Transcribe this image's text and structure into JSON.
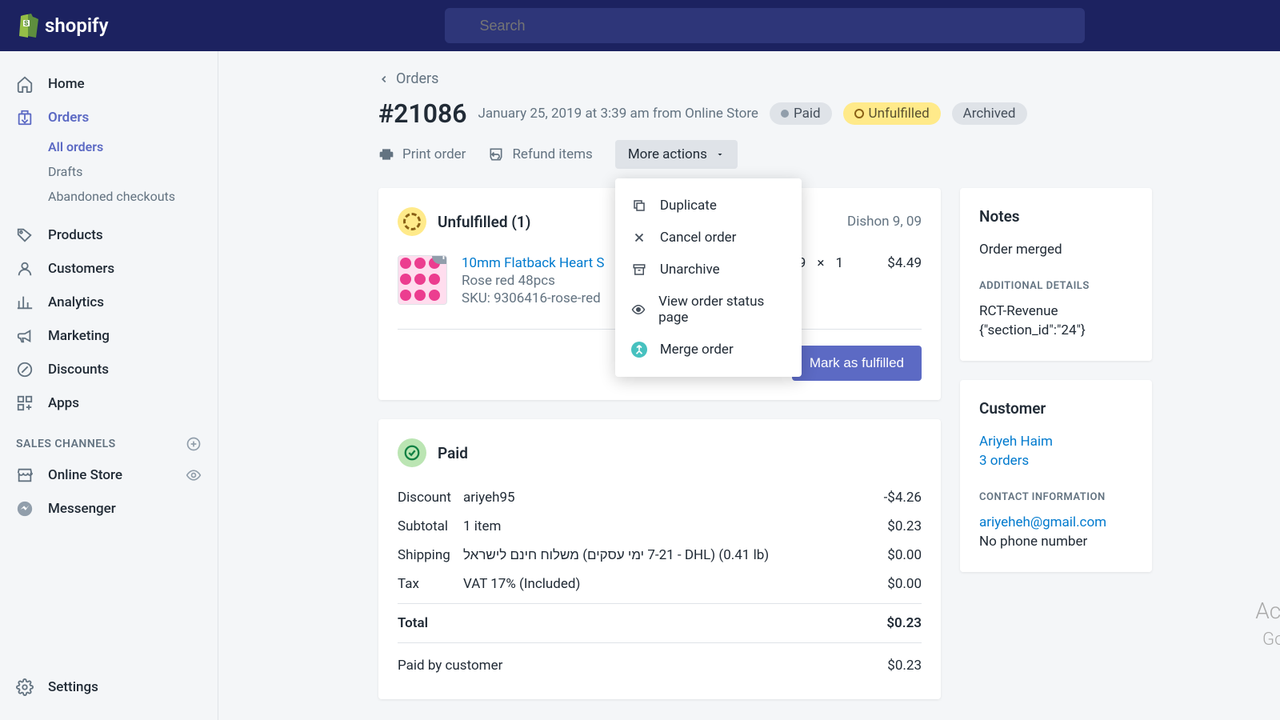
{
  "brand": "shopify",
  "search": {
    "placeholder": "Search"
  },
  "nav": {
    "home": "Home",
    "orders": "Orders",
    "all_orders": "All orders",
    "drafts": "Drafts",
    "abandoned": "Abandoned checkouts",
    "products": "Products",
    "customers": "Customers",
    "analytics": "Analytics",
    "marketing": "Marketing",
    "discounts": "Discounts",
    "apps": "Apps",
    "sales_channels": "SALES CHANNELS",
    "online_store": "Online Store",
    "messenger": "Messenger",
    "settings": "Settings"
  },
  "breadcrumb": "Orders",
  "order": {
    "number": "#21086",
    "meta": "January 25, 2019 at 3:39 am from Online Store",
    "badge_paid": "Paid",
    "badge_unfulfilled": "Unfulfilled",
    "badge_archived": "Archived"
  },
  "actions": {
    "print": "Print order",
    "refund": "Refund items",
    "more": "More actions"
  },
  "dropdown": {
    "duplicate": "Duplicate",
    "cancel": "Cancel order",
    "unarchive": "Unarchive",
    "view_status": "View order status page",
    "merge": "Merge order"
  },
  "fulfillment": {
    "heading": "Unfulfilled (1)",
    "location": "Dishon 9, 09",
    "line": {
      "name": "10mm Flatback Heart S",
      "variant": "Rose red 48pcs",
      "sku": "SKU: 9306416-rose-red",
      "price": "49",
      "times": "×",
      "qty": "1",
      "total": "$4.49",
      "badge": "1"
    },
    "button": "Mark as fulfilled"
  },
  "paid": {
    "heading": "Paid",
    "rows": {
      "discount_label": "Discount",
      "discount_desc": "ariyeh95",
      "discount_amt": "-$4.26",
      "subtotal_label": "Subtotal",
      "subtotal_desc": "1 item",
      "subtotal_amt": "$0.23",
      "shipping_label": "Shipping",
      "shipping_desc": "משלוח חינם לישראל (7-21 ימי עסקים - DHL) (0.41 lb)",
      "shipping_amt": "$0.00",
      "tax_label": "Tax",
      "tax_desc": "VAT 17% (Included)",
      "tax_amt": "$0.00",
      "total_label": "Total",
      "total_amt": "$0.23",
      "paidby_label": "Paid by customer",
      "paidby_amt": "$0.23"
    }
  },
  "notes": {
    "title": "Notes",
    "content": "Order merged",
    "additional_title": "ADDITIONAL DETAILS",
    "add_line1": "RCT-Revenue",
    "add_line2": "{\"section_id\":\"24\"}"
  },
  "customer": {
    "title": "Customer",
    "name": "Ariyeh Haim",
    "orders": "3 orders",
    "contact_title": "CONTACT INFORMATION",
    "email": "ariyeheh@gmail.com",
    "phone": "No phone number"
  },
  "watermark": {
    "l1": "Activ",
    "l2": "Go to"
  }
}
